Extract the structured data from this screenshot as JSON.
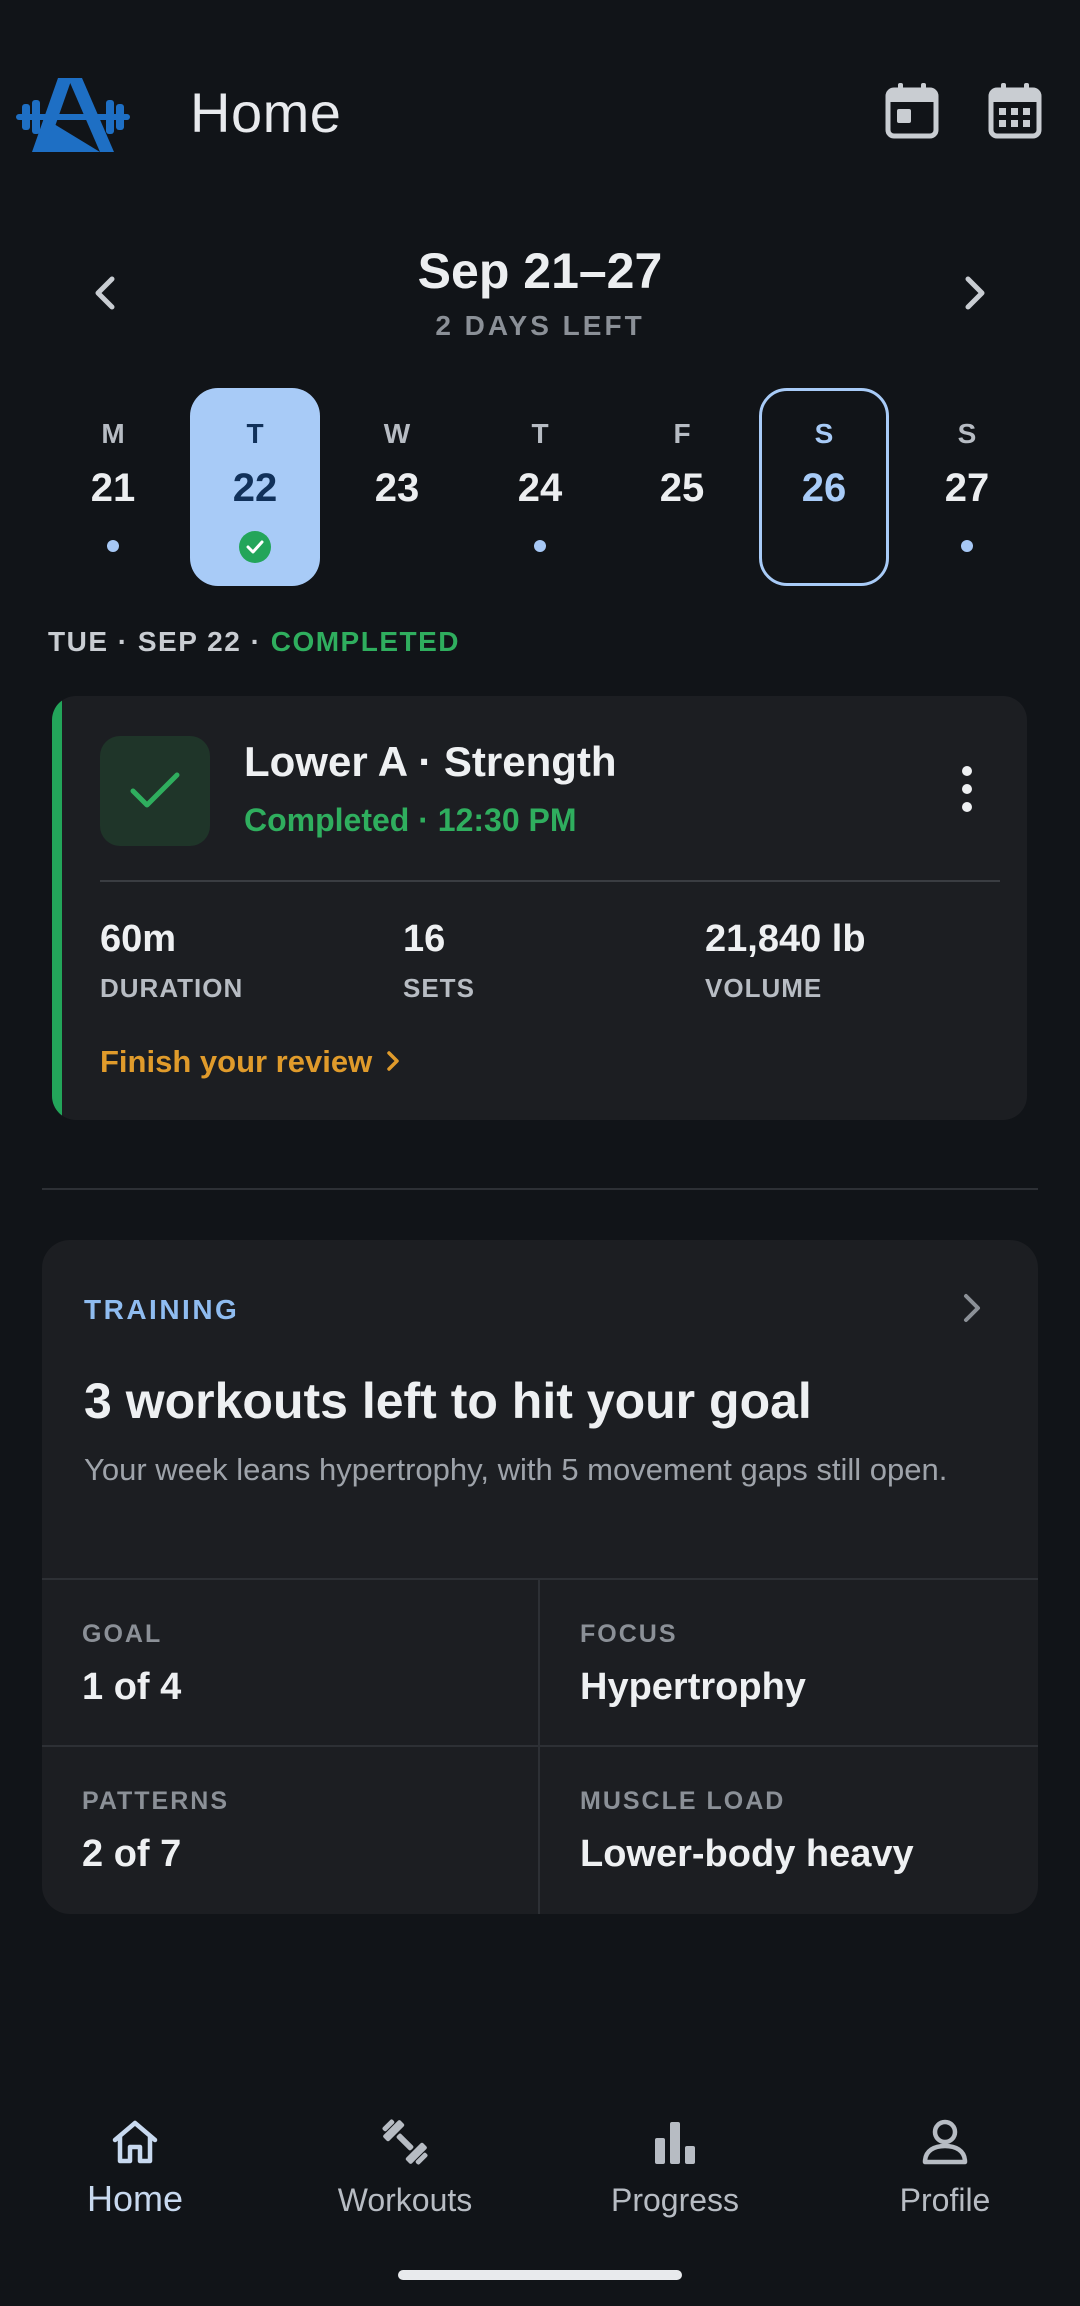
{
  "header": {
    "title": "Home",
    "logo_icon": "barbell-triangle-logo",
    "today_icon": "calendar-today-icon",
    "calendar_icon": "calendar-month-icon",
    "brand_color": "#1e6fc4"
  },
  "week": {
    "range": "Sep 21–27",
    "remaining": "2 DAYS LEFT",
    "days": [
      {
        "letter": "M",
        "num": "21",
        "state": "dot"
      },
      {
        "letter": "T",
        "num": "22",
        "state": "selected-completed"
      },
      {
        "letter": "W",
        "num": "23",
        "state": "none"
      },
      {
        "letter": "T",
        "num": "24",
        "state": "dot"
      },
      {
        "letter": "F",
        "num": "25",
        "state": "none"
      },
      {
        "letter": "S",
        "num": "26",
        "state": "today"
      },
      {
        "letter": "S",
        "num": "27",
        "state": "dot"
      }
    ]
  },
  "selected_day": {
    "label": "TUE · SEP 22 · ",
    "status": "COMPLETED"
  },
  "workout": {
    "title": "Lower A · Strength",
    "subtitle": "Completed · 12:30 PM",
    "stats": [
      {
        "value": "60m",
        "label": "DURATION"
      },
      {
        "value": "16",
        "label": "SETS"
      },
      {
        "value": "21,840 lb",
        "label": "VOLUME"
      }
    ],
    "review_link": "Finish your review",
    "accent_color": "#23a55a"
  },
  "training": {
    "eyebrow": "TRAINING",
    "headline": "3 workouts left to hit your goal",
    "body": "Your week leans hypertrophy, with 5 movement gaps still open.",
    "cells": [
      {
        "label": "GOAL",
        "value": "1 of 4"
      },
      {
        "label": "FOCUS",
        "value": "Hypertrophy"
      },
      {
        "label": "PATTERNS",
        "value": "2 of 7"
      },
      {
        "label": "MUSCLE LOAD",
        "value": "Lower-body heavy"
      }
    ]
  },
  "nav": {
    "items": [
      {
        "label": "Home",
        "icon": "home-icon",
        "active": true
      },
      {
        "label": "Workouts",
        "icon": "dumbbell-icon",
        "active": false
      },
      {
        "label": "Progress",
        "icon": "bar-chart-icon",
        "active": false
      },
      {
        "label": "Profile",
        "icon": "person-icon",
        "active": false
      }
    ]
  }
}
